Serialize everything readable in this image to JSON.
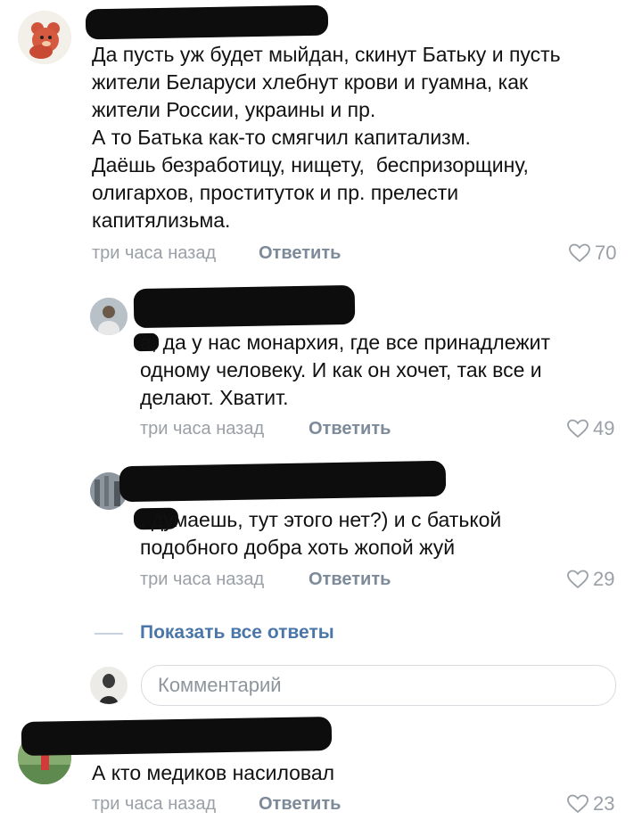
{
  "comments": [
    {
      "text": "Да пусть уж будет мыйдан, скинут Батьку и пусть\nжители Беларуси хлебнут крови и гуамна, как\nжители России, украины и пр.\nА то Батька как-то смягчил капитализм.\nДаёшь безработицу, нищету,  беспризорщину,\nолигархов, проституток и пр. прелести\nкапитялизьма.",
      "time": "три часа назад",
      "reply": "Ответить",
      "likes": "70"
    },
    {
      "text": "а, да у нас монархия, где все принадлежит\nодному человеку. И как он хочет, так все и\nделают. Хватит.",
      "time": "три часа назад",
      "reply": "Ответить",
      "likes": "49"
    },
    {
      "text": ", думаешь, тут этого нет?) и с батькой\nподобного добра хоть жопой жуй",
      "time": "три часа назад",
      "reply": "Ответить",
      "likes": "29"
    },
    {
      "text": "А кто медиков насиловал",
      "time": "три часа назад",
      "reply": "Ответить",
      "likes": "23"
    }
  ],
  "show_all_replies": "Показать все ответы",
  "comment_input": {
    "placeholder": "Комментарий"
  },
  "colors": {
    "link": "#4a76a8",
    "meta": "#9aa0a6",
    "reply": "#7d8a99"
  }
}
